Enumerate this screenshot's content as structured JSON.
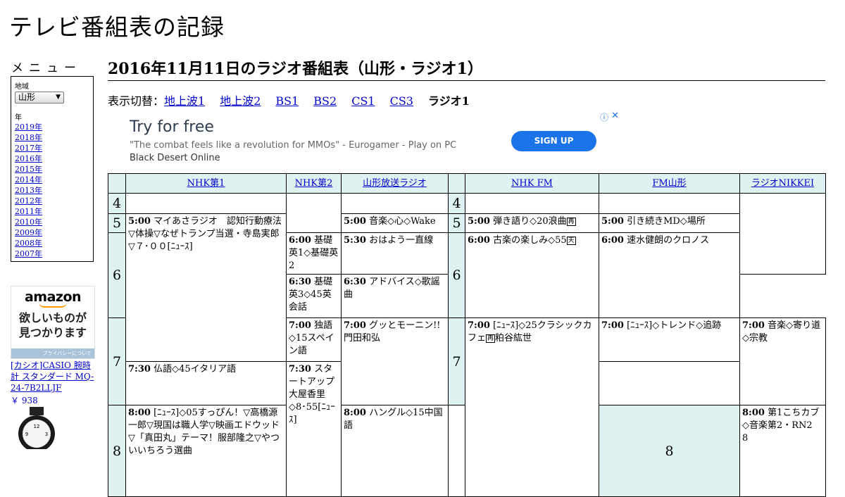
{
  "site": {
    "title": "テレビ番組表の記録"
  },
  "sidebar": {
    "menu_title": "メニュー",
    "region_label": "地域",
    "region_value": "山形",
    "year_label": "年",
    "years": [
      "2019年",
      "2018年",
      "2017年",
      "2016年",
      "2015年",
      "2014年",
      "2013年",
      "2012年",
      "2011年",
      "2010年",
      "2009年",
      "2008年",
      "2007年"
    ]
  },
  "ads": {
    "amazon": {
      "logo": "amazon",
      "copy_line1": "欲しいものが",
      "copy_line2": "見つかります",
      "privacy": "プライバシーについて"
    },
    "product": {
      "name": "[カシオ]CASIO 腕時計 スタンダード MQ-24-7B2LLJF",
      "price": "￥ 938"
    },
    "banner": {
      "title": "Try for free",
      "text_quote": "\"The combat feels like a revolution for MMOs\" - Eurogamer - Play on PC",
      "text_brand": "Black Desert Online",
      "button": "SIGN UP",
      "info_icon": "ⓘ",
      "close_icon": "✕"
    }
  },
  "main": {
    "heading": "2016年11月11日のラジオ番組表（山形・ラジオ1）",
    "switch_label": "表示切替：",
    "switch_links": [
      "地上波1",
      "地上波2",
      "BS1",
      "BS2",
      "CS1",
      "CS3"
    ],
    "switch_current": "ラジオ1"
  },
  "schedule": {
    "channels": [
      "NHK第1",
      "NHK第2",
      "山形放送ラジオ",
      "NHK FM",
      "FM山形",
      "ラジオNIKKEI"
    ],
    "hours": [
      "4",
      "5",
      "6",
      "7",
      "8"
    ],
    "programs": {
      "nhk1_500": {
        "time": "5:00",
        "title": "マイあさラジオ　認知行動療法▽体操▽なぜトランプ当選・寺島実郎▽７･００[ﾆｭｰｽ]"
      },
      "nhk1_800": {
        "time": "8:00",
        "title": "[ﾆｭｰｽ]◇05すっぴん！▽高橋源一郎▽現国は職人学▽映画エドウッド▽「真田丸」テーマ！服部隆之▽やついいちろう選曲"
      },
      "nhk2_600": {
        "time": "6:00",
        "title": "基礎英1◇基礎英2"
      },
      "nhk2_630": {
        "time": "6:30",
        "title": "基礎英3◇45英会話"
      },
      "nhk2_700": {
        "time": "7:00",
        "title": "独語◇15スペイン語"
      },
      "nhk2_730": {
        "time": "7:30",
        "title": "仏語◇45イタリア語"
      },
      "nhk2_800": {
        "time": "8:00",
        "title": "ハングル◇15中国語"
      },
      "ybc_500": {
        "time": "5:00",
        "title": "音楽◇心◇Wake"
      },
      "ybc_530": {
        "time": "5:30",
        "title": "おはよう一直線"
      },
      "ybc_630": {
        "time": "6:30",
        "title": "アドバイス◇歌謡曲"
      },
      "ybc_700": {
        "time": "7:00",
        "title": "グッとモーニン!!門田和弘"
      },
      "fm_500": {
        "time": "5:00",
        "title": "弾き語り◇20浪曲",
        "mark": "再"
      },
      "fm_600": {
        "time": "6:00",
        "title": "古楽の楽しみ◇55",
        "mark": "天"
      },
      "fm_700": {
        "time": "7:00",
        "title": "[ﾆｭｰｽ]◇25クラシックカフェ",
        "mark": "再",
        "tail": "粕谷紘世"
      },
      "fmy_500": {
        "time": "5:00",
        "title": "引き続きMD◇場所"
      },
      "fmy_600": {
        "time": "6:00",
        "title": "速水健朗のクロノス"
      },
      "fmy_700": {
        "time": "7:00",
        "title": "[ﾆｭｰｽ]◇トレンド◇追跡"
      },
      "fmy_730": {
        "time": "7:30",
        "title": "スタートアップ大屋香里◇8･55[ﾆｭｰｽ]"
      },
      "nikkei_700": {
        "time": "7:00",
        "title": "音楽◇寄り道◇宗教"
      },
      "nikkei_800": {
        "time": "8:00",
        "title": "第1こちカブ◇音楽第2・RN2　8"
      }
    }
  }
}
